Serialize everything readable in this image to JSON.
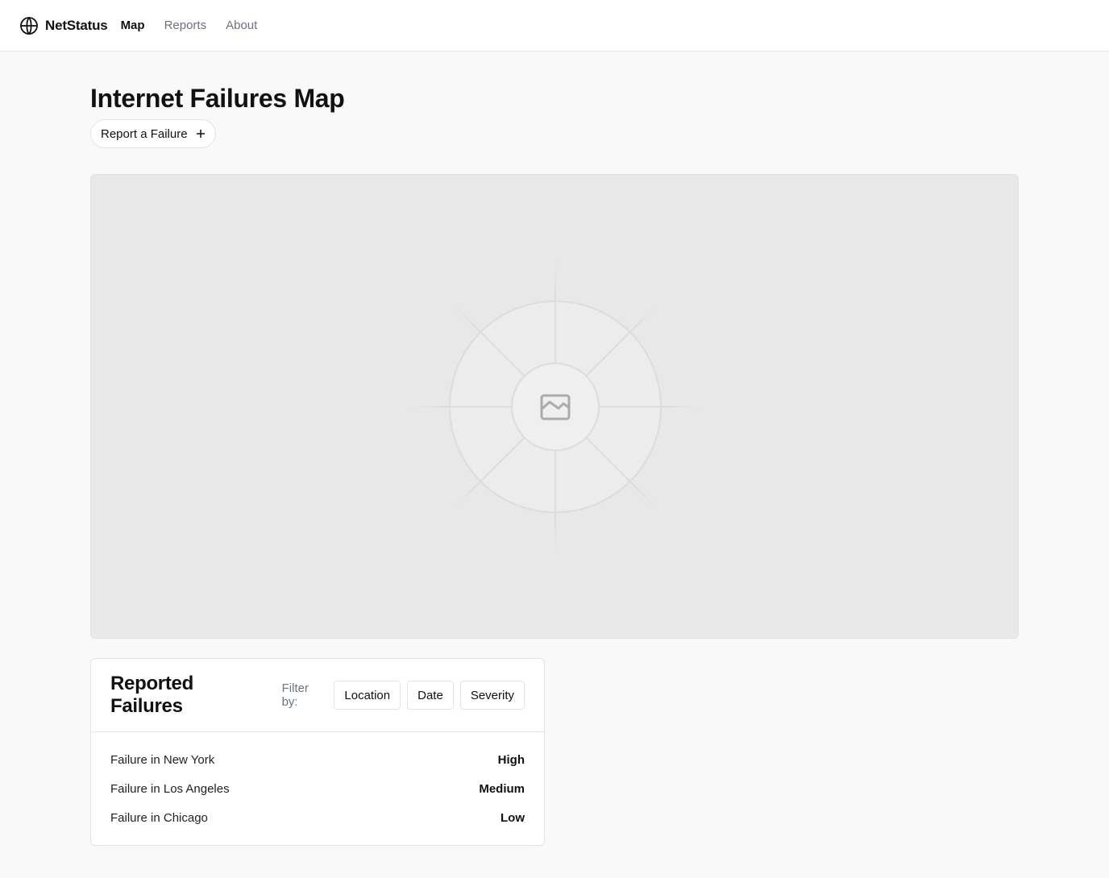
{
  "app": {
    "name": "NetStatus",
    "nav": [
      {
        "label": "Map",
        "active": true
      },
      {
        "label": "Reports",
        "active": false
      },
      {
        "label": "About",
        "active": false
      }
    ]
  },
  "page": {
    "title": "Internet Failures Map",
    "report_button": "Report a Failure"
  },
  "map": {
    "placeholder_icon": "image-placeholder-icon"
  },
  "failures": {
    "title": "Reported Failures",
    "filter_label": "Filter by:",
    "filters": [
      "Location",
      "Date",
      "Severity"
    ],
    "items": [
      {
        "name": "Failure in New York",
        "severity": "High"
      },
      {
        "name": "Failure in Los Angeles",
        "severity": "Medium"
      },
      {
        "name": "Failure in Chicago",
        "severity": "Low"
      }
    ]
  },
  "colors": {
    "background": "#f8f9f8",
    "muted_text": "#6b7280",
    "map_placeholder": "#e8e8e8"
  }
}
